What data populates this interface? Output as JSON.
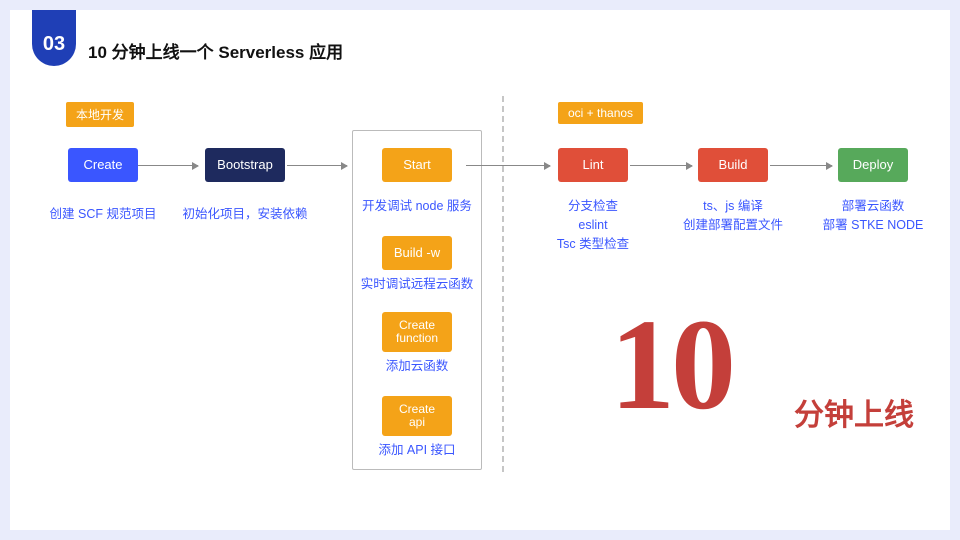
{
  "header": {
    "section_number": "03",
    "title": "10 分钟上线一个 Serverless 应用"
  },
  "tags": {
    "local_dev": "本地开发",
    "oci_thanos": "oci + thanos"
  },
  "main_steps": {
    "create": {
      "label": "Create",
      "caption": "创建 SCF 规范项目"
    },
    "bootstrap": {
      "label": "Bootstrap",
      "caption": "初始化项目，安装依赖"
    },
    "start": {
      "label": "Start",
      "caption": "开发调试 node 服务"
    },
    "lint": {
      "label": "Lint",
      "caption": "分支检查\neslint\nTsc 类型检查"
    },
    "build": {
      "label": "Build",
      "caption": "ts、js 编译\n创建部署配置文件"
    },
    "deploy": {
      "label": "Deploy",
      "caption": "部署云函数\n部署 STKE NODE"
    }
  },
  "sub_steps": {
    "build_w": {
      "label": "Build -w",
      "caption": "实时调试远程云函数"
    },
    "create_fn": {
      "label": "Create\nfunction",
      "caption": "添加云函数"
    },
    "create_api": {
      "label": "Create\napi",
      "caption": "添加 API 接口"
    }
  },
  "callout": {
    "number": "10",
    "text": "分钟上线"
  },
  "colors": {
    "blue": "#3a56ff",
    "navy": "#1e2a5e",
    "orange": "#f4a318",
    "red": "#e04f39",
    "green": "#57a95b",
    "accent_red": "#c43f3a"
  }
}
